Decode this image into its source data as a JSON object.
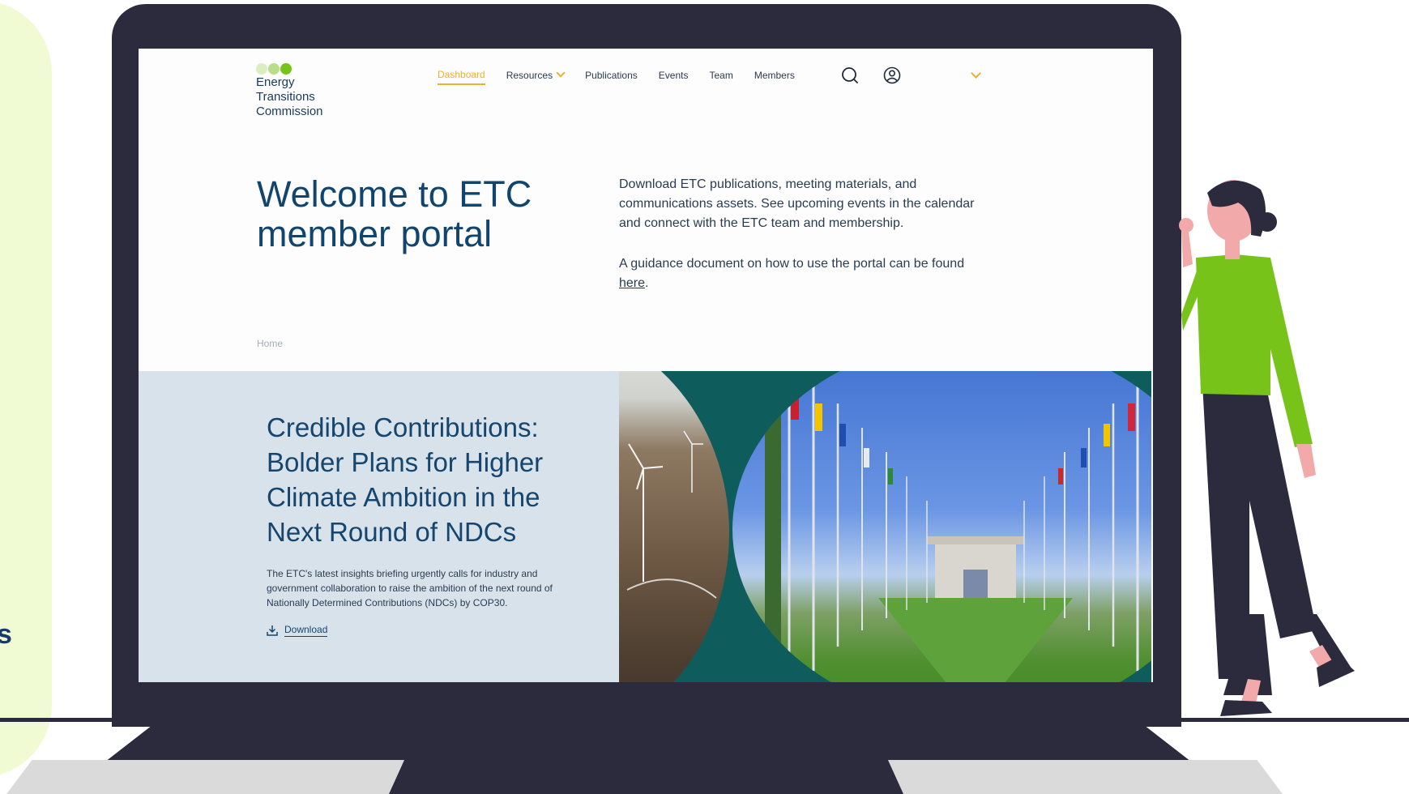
{
  "logo": {
    "name_lines": [
      "Energy",
      "Transitions",
      "Commission"
    ],
    "dot_colors": [
      "#dbeec0",
      "#b8df88",
      "#78c31a"
    ]
  },
  "nav": {
    "items": [
      {
        "label": "Dashboard",
        "active": true
      },
      {
        "label": "Resources",
        "has_dropdown": true
      },
      {
        "label": "Publications"
      },
      {
        "label": "Events"
      },
      {
        "label": "Team"
      },
      {
        "label": "Members"
      }
    ],
    "icons": [
      "search-icon",
      "user-account-icon",
      "chevron-down-icon"
    ]
  },
  "hero": {
    "title": "Welcome to ETC member portal",
    "description": "Download ETC publications, meeting materials, and communications assets. See upcoming events in the calendar and connect with the ETC team and membership.",
    "guide_prefix": "A guidance document on how to use the portal can be found ",
    "guide_link": "here",
    "guide_suffix": "."
  },
  "breadcrumb": {
    "label": "Home"
  },
  "feature": {
    "title": "Credible Contributions: Bolder Plans for Higher Climate Ambition in the Next Round of NDCs",
    "description": "The ETC's latest insights briefing urgently calls for industry and government collaboration to raise the ambition of the next round of Nationally Determined Contributions (NDCs) by COP30.",
    "download_label": "Download"
  },
  "colors": {
    "accent": "#f0b02b",
    "brand_blue": "#12456e",
    "panel": "#d8e2ea",
    "laptop": "#2c2b3d",
    "figure_shirt": "#78c31a",
    "teal": "#0f5c5c"
  }
}
